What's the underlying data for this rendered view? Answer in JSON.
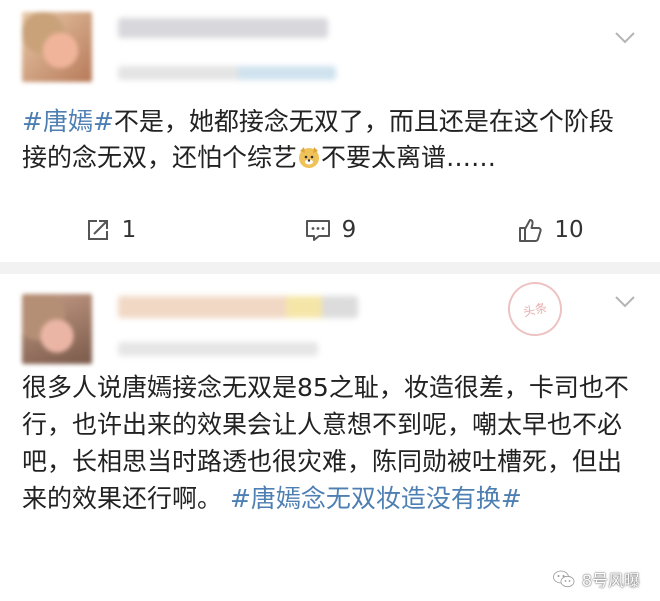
{
  "posts": [
    {
      "hashtag": "#唐嫣#",
      "text_parts": [
        "不是，她都接念无双了，而且还是在这个阶段接的念无双，还怕个综艺",
        "不要太离谱……"
      ],
      "actions": {
        "repost_count": "1",
        "comment_count": "9",
        "like_count": "10"
      }
    },
    {
      "stamp": "头条",
      "text": "很多人说唐嫣接念无双是85之耻，妆造很差，卡司也不行，也许出来的效果会让人意想不到呢，嘲太早也不必吧，长相思当时路透也很灾难，陈同勋被吐槽死，但出来的效果还行啊。",
      "hashtag": "#唐嫣念无双妆造没有换#"
    }
  ],
  "watermark": "8号风曝",
  "colors": {
    "link": "#4e7fb3",
    "divider": "#f2f2f2",
    "icon": "#555555"
  }
}
